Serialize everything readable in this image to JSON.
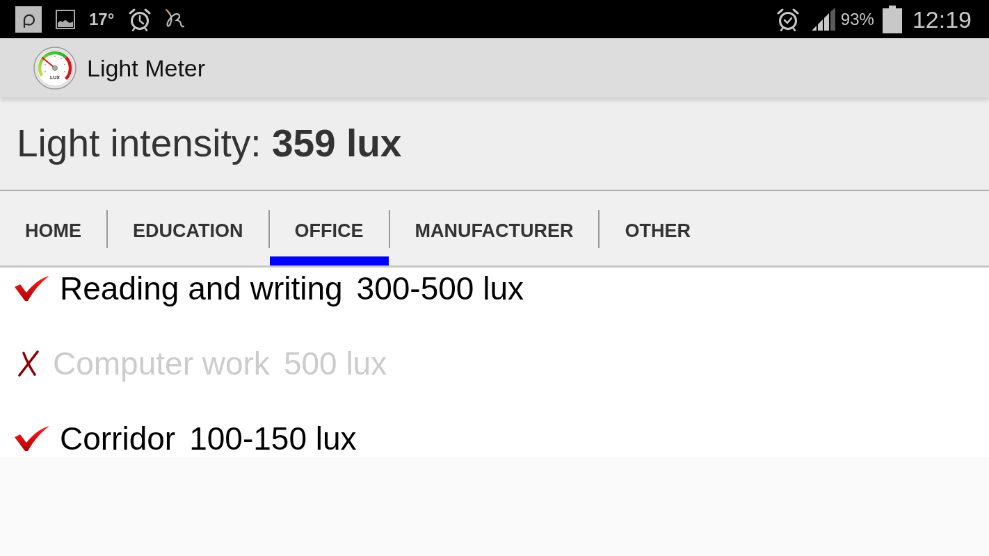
{
  "status_bar": {
    "temperature": "17°",
    "battery": "93%",
    "time": "12:19"
  },
  "action_bar": {
    "logo_label": "LUX",
    "title": "Light Meter"
  },
  "reading": {
    "text": "Light intensity: **359 lux**"
  },
  "tabs": [
    {
      "label": "HOME",
      "selected": false
    },
    {
      "label": "EDUCATION",
      "selected": false
    },
    {
      "label": "OFFICE",
      "selected": true
    },
    {
      "label": "MANUFACTURER",
      "selected": false
    },
    {
      "label": "OTHER",
      "selected": false
    }
  ],
  "items": [
    {
      "name": "Reading and writing",
      "range": "300-500 lux",
      "met": true
    },
    {
      "name": "Computer work",
      "range": "500 lux",
      "met": false
    },
    {
      "name": "Corridor",
      "range": "100-150 lux",
      "met": true
    }
  ]
}
